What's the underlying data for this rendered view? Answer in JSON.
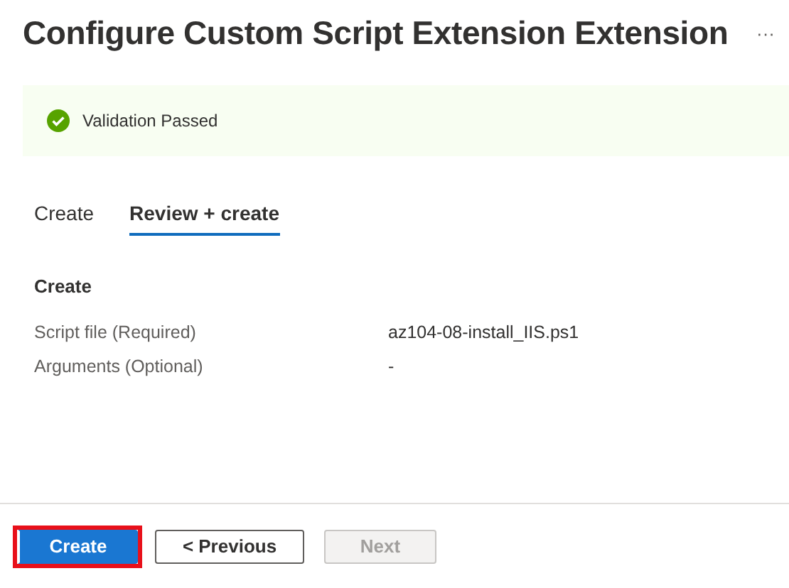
{
  "title": "Configure Custom Script Extension Extension",
  "more": "···",
  "banner": {
    "kind": "success",
    "text": "Validation Passed"
  },
  "tabs": [
    {
      "label": "Create",
      "selected": false
    },
    {
      "label": "Review + create",
      "selected": true
    }
  ],
  "section": {
    "heading": "Create",
    "rows": [
      {
        "label": "Script file (Required)",
        "value": "az104-08-install_IIS.ps1"
      },
      {
        "label": "Arguments (Optional)",
        "value": "-"
      }
    ]
  },
  "buttons": [
    {
      "label": "Create",
      "kind": "primary",
      "disabled": false,
      "highlighted": true
    },
    {
      "label": "< Previous",
      "kind": "secondary",
      "disabled": false,
      "highlighted": false
    },
    {
      "label": "Next",
      "kind": "secondary",
      "disabled": true,
      "highlighted": false
    }
  ]
}
